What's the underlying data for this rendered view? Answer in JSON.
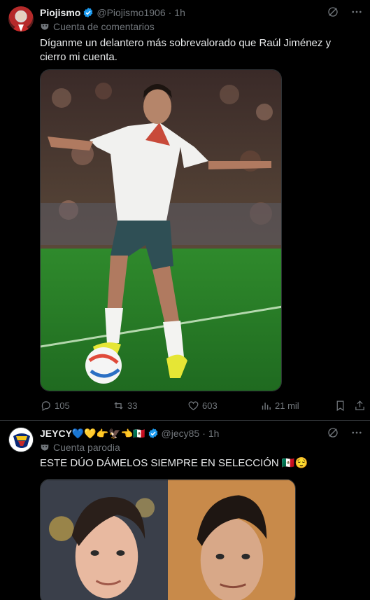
{
  "posts": [
    {
      "display_name": "Piojismo",
      "handle": "@Piojismo1906",
      "separator": "·",
      "time": "1h",
      "account_label": "Cuenta de comentarios",
      "text": "Díganme un delantero más sobrevalorado que Raúl Jiménez y cierro mi cuenta.",
      "stats": {
        "replies": "105",
        "reposts": "33",
        "likes": "603",
        "views": "21 mil"
      }
    },
    {
      "display_name": "JEYCY💙💛👉🦅👈🇲🇽",
      "handle": "@jecy85",
      "separator": "·",
      "time": "1h",
      "account_label": "Cuenta parodia",
      "text": "ESTE DÚO DÁMELOS SIEMPRE EN SELECCIÓN 🇲🇽😌"
    }
  ],
  "colors": {
    "background": "#000000",
    "text_primary": "#e7e9ea",
    "text_secondary": "#71767b",
    "verified_blue": "#1d9bf0",
    "divider": "#2f3336"
  },
  "icons": [
    "verified-badge-icon",
    "grok-icon",
    "more-icon",
    "mask-icon",
    "reply-icon",
    "repost-icon",
    "like-icon",
    "views-icon",
    "bookmark-icon",
    "share-icon"
  ]
}
